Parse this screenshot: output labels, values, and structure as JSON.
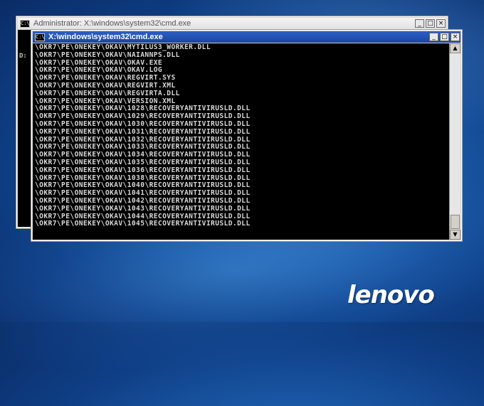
{
  "back_window": {
    "title": "Administrator: X:\\windows\\system32\\cmd.exe",
    "console_partial": "D:"
  },
  "front_window": {
    "title": "X:\\windows\\system32\\cmd.exe",
    "icon_label": "C:\\",
    "controls": {
      "minimize": "_",
      "maximize": "□",
      "close": "×"
    }
  },
  "console_lines": [
    "\\OKR7\\PE\\ONEKEY\\OKAV\\MYTILUS3_WORKER.DLL",
    "\\OKR7\\PE\\ONEKEY\\OKAV\\NAIANNPS.DLL",
    "\\OKR7\\PE\\ONEKEY\\OKAV\\OKAV.EXE",
    "\\OKR7\\PE\\ONEKEY\\OKAV\\OKAV.LOG",
    "\\OKR7\\PE\\ONEKEY\\OKAV\\REGVIRT.SYS",
    "\\OKR7\\PE\\ONEKEY\\OKAV\\REGVIRT.XML",
    "\\OKR7\\PE\\ONEKEY\\OKAV\\REGVIRTA.DLL",
    "\\OKR7\\PE\\ONEKEY\\OKAV\\VERSION.XML",
    "\\OKR7\\PE\\ONEKEY\\OKAV\\1028\\RECOVERYANTIVIRUSLD.DLL",
    "\\OKR7\\PE\\ONEKEY\\OKAV\\1029\\RECOVERYANTIVIRUSLD.DLL",
    "\\OKR7\\PE\\ONEKEY\\OKAV\\1030\\RECOVERYANTIVIRUSLD.DLL",
    "\\OKR7\\PE\\ONEKEY\\OKAV\\1031\\RECOVERYANTIVIRUSLD.DLL",
    "\\OKR7\\PE\\ONEKEY\\OKAV\\1032\\RECOVERYANTIVIRUSLD.DLL",
    "\\OKR7\\PE\\ONEKEY\\OKAV\\1033\\RECOVERYANTIVIRUSLD.DLL",
    "\\OKR7\\PE\\ONEKEY\\OKAV\\1034\\RECOVERYANTIVIRUSLD.DLL",
    "\\OKR7\\PE\\ONEKEY\\OKAV\\1035\\RECOVERYANTIVIRUSLD.DLL",
    "\\OKR7\\PE\\ONEKEY\\OKAV\\1036\\RECOVERYANTIVIRUSLD.DLL",
    "\\OKR7\\PE\\ONEKEY\\OKAV\\1038\\RECOVERYANTIVIRUSLD.DLL",
    "\\OKR7\\PE\\ONEKEY\\OKAV\\1040\\RECOVERYANTIVIRUSLD.DLL",
    "\\OKR7\\PE\\ONEKEY\\OKAV\\1041\\RECOVERYANTIVIRUSLD.DLL",
    "\\OKR7\\PE\\ONEKEY\\OKAV\\1042\\RECOVERYANTIVIRUSLD.DLL",
    "\\OKR7\\PE\\ONEKEY\\OKAV\\1043\\RECOVERYANTIVIRUSLD.DLL",
    "\\OKR7\\PE\\ONEKEY\\OKAV\\1044\\RECOVERYANTIVIRUSLD.DLL",
    "\\OKR7\\PE\\ONEKEY\\OKAV\\1045\\RECOVERYANTIVIRUSLD.DLL"
  ],
  "scrollbar": {
    "up_glyph": "▲",
    "down_glyph": "▼"
  },
  "brand_logo": "lenovo",
  "colors": {
    "desktop_blue": "#1b5aa8",
    "titlebar_active": "#2b5fc4",
    "console_bg": "#000000",
    "console_text": "#d8d8d8"
  }
}
